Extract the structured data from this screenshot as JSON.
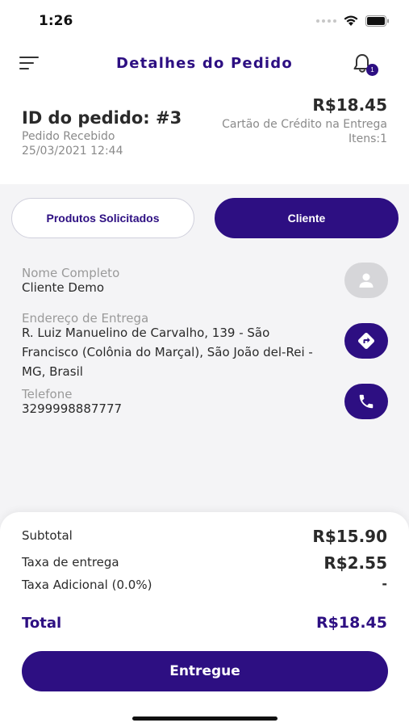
{
  "status_bar": {
    "time": "1:26"
  },
  "header": {
    "title": "Detalhes do Pedido",
    "notification_count": "1"
  },
  "order": {
    "id": "ID do pedido: #3",
    "status": "Pedido Recebido",
    "date": "25/03/2021 12:44",
    "total": "R$18.45",
    "payment_method": "Cartão de Crédito na Entrega",
    "items": "Itens:1"
  },
  "tabs": [
    {
      "label": "Produtos Solicitados",
      "active": false
    },
    {
      "label": "Cliente",
      "active": true
    }
  ],
  "client": {
    "name_label": "Nome Completo",
    "name": "Cliente Demo",
    "address_label": "Endereço de Entrega",
    "address": "R. Luiz Manuelino de Carvalho, 139 - São Francisco (Colônia do Marçal), São João del-Rei - MG, Brasil",
    "phone_label": "Telefone",
    "phone": "3299998887777"
  },
  "summary": {
    "subtotal_label": "Subtotal",
    "subtotal": "R$15.90",
    "delivery_fee_label": "Taxa de entrega",
    "delivery_fee": "R$2.55",
    "extra_fee_label": "Taxa Adicional (0.0%)",
    "extra_fee": "-",
    "total_label": "Total",
    "total": "R$18.45",
    "action_label": "Entregue"
  },
  "icons": {
    "menu": "menu-icon",
    "bell": "bell-icon",
    "user": "user-icon",
    "directions": "directions-icon",
    "phone": "phone-icon"
  },
  "colors": {
    "primary": "#2d0f82",
    "background": "#f4f4f6",
    "muted_text": "#8a8a8a"
  }
}
